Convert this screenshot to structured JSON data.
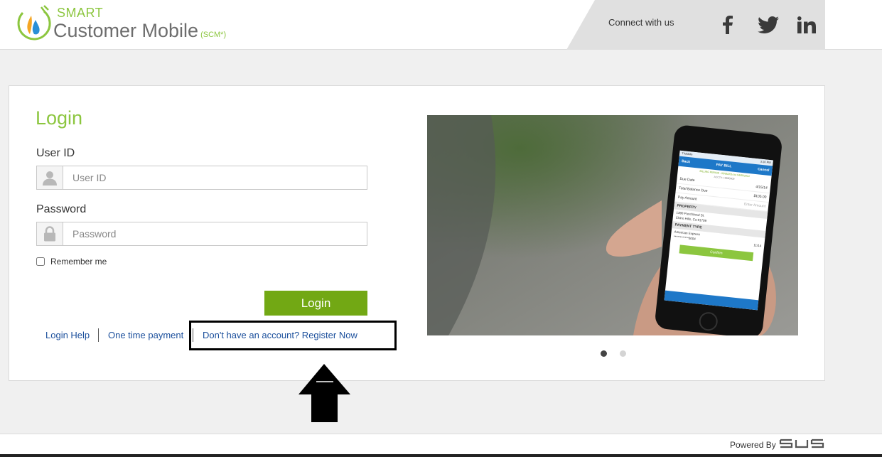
{
  "header": {
    "brand_small": "SMART",
    "brand_big": "Customer Mobile",
    "brand_suffix": "(SCM*)",
    "connect_label": "Connect with us",
    "social": [
      "facebook-icon",
      "twitter-icon",
      "linkedin-icon"
    ]
  },
  "login": {
    "title": "Login",
    "userid_label": "User ID",
    "userid_placeholder": "User ID",
    "password_label": "Password",
    "password_placeholder": "Password",
    "remember_label": "Remember me",
    "remember_checked": false,
    "button_label": "Login"
  },
  "links": {
    "help": "Login Help",
    "one_time_payment": "One time payment",
    "register": "Don't have an account? Register Now"
  },
  "carousel": {
    "slides": 2,
    "active_index": 0
  },
  "phone": {
    "carrier": "T-Mobile",
    "time": "3:10 PM",
    "back_label": "Back",
    "screen_title": "PAY BILL",
    "cancel_label": "Cancel",
    "billing_period": "BILLING PERIOD : 03/05/2014 to 04/05/2014",
    "account": "ACCT#: 18880009",
    "due_date_label": "Due Date",
    "due_date_value": "4/15/14",
    "balance_label": "Total Balance Due",
    "balance_value": "$105.00",
    "pay_amount_label": "Pay Amount",
    "pay_amount_placeholder": "Enter Amount",
    "property_header": "PROPERTY",
    "property_line1": "1390 Punchbowl St.",
    "property_line2": "Chino Hills, Ca 91709",
    "payment_type_header": "PAYMENT TYPE",
    "card_name": "American Express",
    "card_number": "************0004",
    "card_exp": "11/14",
    "confirm_label": "Confirm"
  },
  "footer": {
    "powered_by": "Powered By",
    "sus_logo": "SUS"
  },
  "colors": {
    "brand_green": "#8cc63f",
    "button_green": "#72a814",
    "link_blue": "#1b4f9c"
  }
}
